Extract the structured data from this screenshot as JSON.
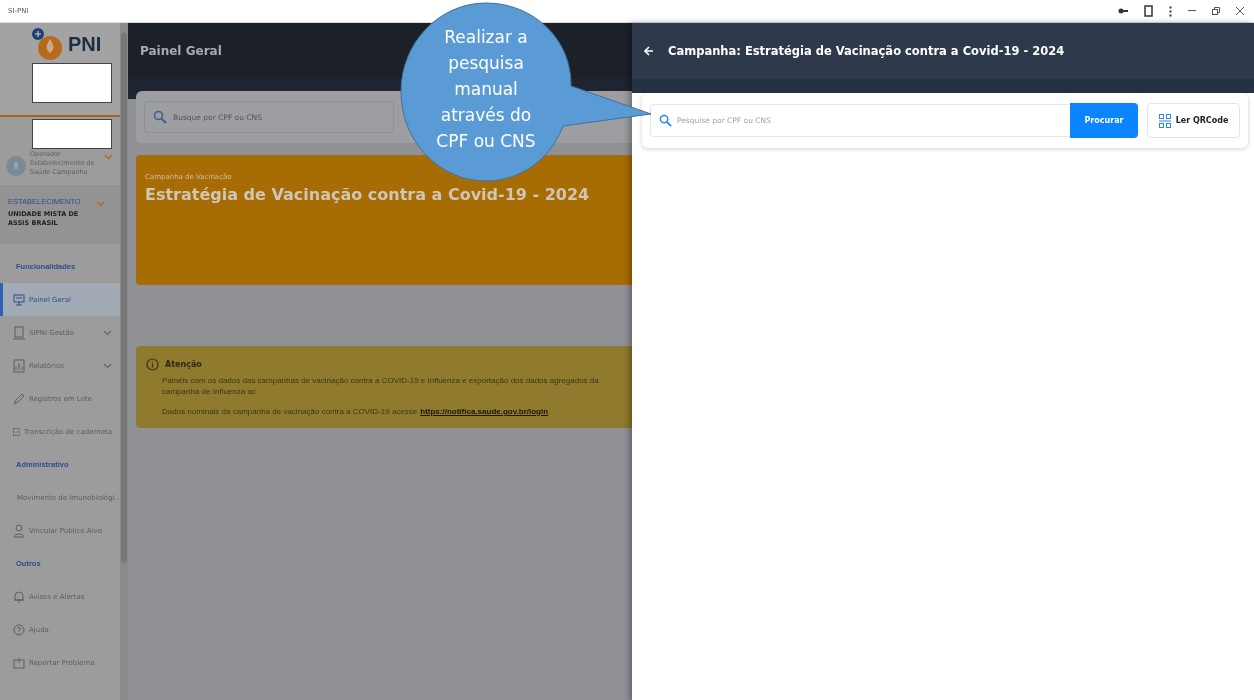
{
  "window": {
    "title": "SI-PNI"
  },
  "sidebar": {
    "logo_text": "PNI",
    "user": {
      "role": "Operador",
      "unit": "Estabelecimento de Saúde Campanha",
      "expanded": false
    },
    "establishment": {
      "label": "ESTABELECIMENTO",
      "name": "UNIDADE MISTA DE ASSIS BRASIL",
      "expanded": false
    },
    "items": [
      {
        "kind": "section",
        "label": "Funcionalidades"
      },
      {
        "kind": "item",
        "label": "Painel Geral",
        "selected": true,
        "has_submenu": false
      },
      {
        "kind": "item",
        "label": "SIPNI Gestão",
        "selected": false,
        "has_submenu": true
      },
      {
        "kind": "item",
        "label": "Relatórios",
        "selected": false,
        "has_submenu": true
      },
      {
        "kind": "item",
        "label": "Registros em Lote",
        "selected": false,
        "has_submenu": false
      },
      {
        "kind": "item",
        "label": "Transcrição de caderneta",
        "selected": false,
        "has_submenu": false
      },
      {
        "kind": "section",
        "label": "Administrativo"
      },
      {
        "kind": "item",
        "label": "Movimento de Imunobiológi...",
        "selected": false,
        "has_submenu": false
      },
      {
        "kind": "item",
        "label": "Vincular Público Alvo",
        "selected": false,
        "has_submenu": false
      },
      {
        "kind": "section",
        "label": "Outros"
      },
      {
        "kind": "item",
        "label": "Avisos e Alertas",
        "selected": false,
        "has_submenu": false
      },
      {
        "kind": "item",
        "label": "Ajuda",
        "selected": false,
        "has_submenu": false
      },
      {
        "kind": "item",
        "label": "Reportar Problema",
        "selected": false,
        "has_submenu": false
      }
    ]
  },
  "main": {
    "title": "Painel Geral",
    "search": {
      "placeholder": "Busque por CPF ou CNS"
    },
    "campaign": {
      "label": "Campanha de Vacinação",
      "title": "Estratégia de Vacinação contra a Covid-19 - 2024"
    },
    "notice": {
      "title": "Atenção",
      "lines": [
        "Painéis com os dados das campanhas de vacinação contra a COVID-19 e Influenza e exportação dos dados agregados da campanha de Influenza ac"
      ],
      "link_text": "Dados nominais da campanha de vacinação contra a COVID-19 acesse",
      "link": "https://notifica.saude.gov.br/login"
    }
  },
  "drawer": {
    "title": "Campanha: Estratégia de Vacinação contra a Covid-19 - 2024",
    "search": {
      "placeholder": "Pesquise por CPF ou CNS"
    },
    "search_button": "Procurar",
    "qr_button": "Ler QRCode"
  },
  "callout": {
    "text": "Realizar a pesquisa manual através do CPF ou CNS"
  }
}
